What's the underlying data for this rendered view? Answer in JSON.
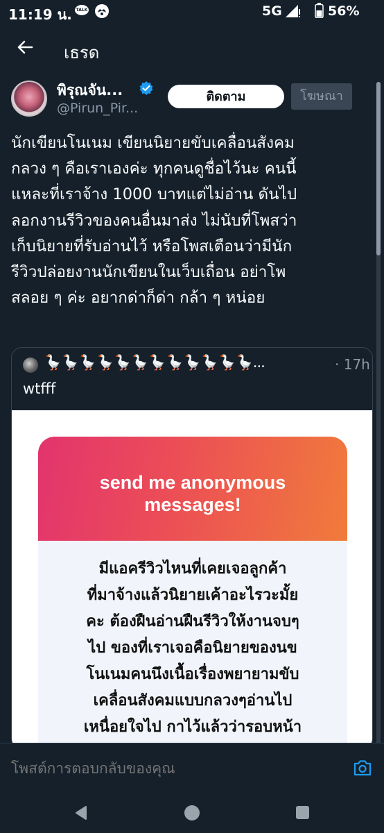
{
  "status_bar": {
    "time": "11:19 น.",
    "talk_badge": "TALK",
    "network": "5G",
    "battery": "56%",
    "icons": [
      "talk-icon",
      "bank-icon",
      "signal-icon",
      "battery-icon"
    ]
  },
  "header": {
    "title": "เธรด",
    "back_icon": "arrow-left-icon"
  },
  "author": {
    "name": "พิรุณจัน...",
    "handle": "@Pirun_Pir...",
    "verified": true,
    "follow_label": "ติดตาม",
    "ad_label": "โฆษณา"
  },
  "tweet": {
    "lines": [
      "นักเขียนโนเนม เขียนนิยายขับเคลื่อนสังคม",
      "กลวง ๆ คือเราเองค่ะ ทุกคนดูชื่อไว้นะ คนนี้",
      "แหละที่เราจ้าง 1000 บาทแต่ไม่อ่าน ดันไป",
      "ลอกงานรีวิวของคนอื่นมาส่ง ไม่นับที่โพสว่า",
      "เก็บนิยายที่รับอ่านไว้ หรือโพสเตือนว่ามีนัก",
      "รีวิวปล่อยงานนักเขียนในเว็บเถื่อน อย่าโพ",
      "สลอย ๆ ค่ะ อยากด่าก็ด่า กล้า ๆ หน่อย"
    ]
  },
  "quote": {
    "name": "🪿🪿🪿🪿🪿🪿🪿🪿🪿🪿🪿🪿...",
    "time": "· 17h",
    "text": "wtfff",
    "image": {
      "card_title_line1": "send me anonymous",
      "card_title_line2": "messages!",
      "message_lines": [
        "มีแอครีวิวไหนที่เคยเจอลูกค้า",
        "ที่มาจ้างแล้วนิยายเค้าอะไรวะมั้ย",
        "คะ ต้องฝืนอ่านฝืนรีวิวให้งานจบๆ",
        "ไป ของที่เราเจอคือนิยายของนข",
        "โนเนมคนนึงเนื้อเรื่องพยายามขับ",
        "เคลื่อนสังคมแบบกลวงๆอ่านไป",
        "เหนื่อยใจไป กาไว้แล้วว่ารอบหน้า"
      ],
      "gradient_colors": [
        "#e2346e",
        "#f07b3b"
      ]
    }
  },
  "reply": {
    "placeholder": "โพสต์การตอบกลับของคุณ",
    "camera_icon": "camera-icon"
  },
  "nav": {
    "icons": [
      "nav-back-icon",
      "nav-home-icon",
      "nav-recents-icon"
    ]
  },
  "colors": {
    "background": "#15202b",
    "accent": "#1d9bf0",
    "muted": "#8b98a5"
  }
}
